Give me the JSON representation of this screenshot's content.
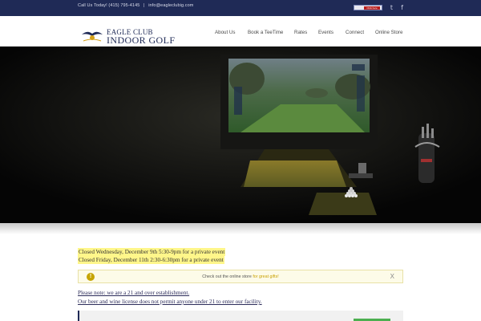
{
  "topbar": {
    "phone_text": "Call Us Today! (415) 795-4145",
    "separator": "|",
    "email": "info@eagleclubig.com",
    "flag_label": "Click here"
  },
  "logo": {
    "line1": "EAGLE CLUB",
    "line2": "INDOOR GOLF"
  },
  "nav": {
    "items": [
      {
        "label": "About Us"
      },
      {
        "label": "Book a TeeTime"
      },
      {
        "label": "Rates"
      },
      {
        "label": "Events"
      },
      {
        "label": "Connect"
      },
      {
        "label": "Online Store"
      }
    ]
  },
  "notices": {
    "closed_1": "Closed Wednesday, December 9th 5:30-9pm for a private event",
    "closed_2": "Closed Friday, December 11th 2:30-6:30pm for a private event"
  },
  "alert": {
    "icon": "!",
    "text": "Check out the online store",
    "link_text": "for great gifts!",
    "close_label": "X"
  },
  "age_note": {
    "line1": "Please note: we are a 21 and over establishment.",
    "line2": "Our beer and wine license does not permit anyone under 21 to enter our facility."
  },
  "icons": {
    "twitter": "twitter-icon",
    "facebook": "facebook-icon",
    "alert": "exclamation-icon",
    "close": "close-icon"
  },
  "colors": {
    "brand_navy": "#1f2a56",
    "highlight_yellow": "#fff68a",
    "alert_gold": "#c6a400"
  }
}
